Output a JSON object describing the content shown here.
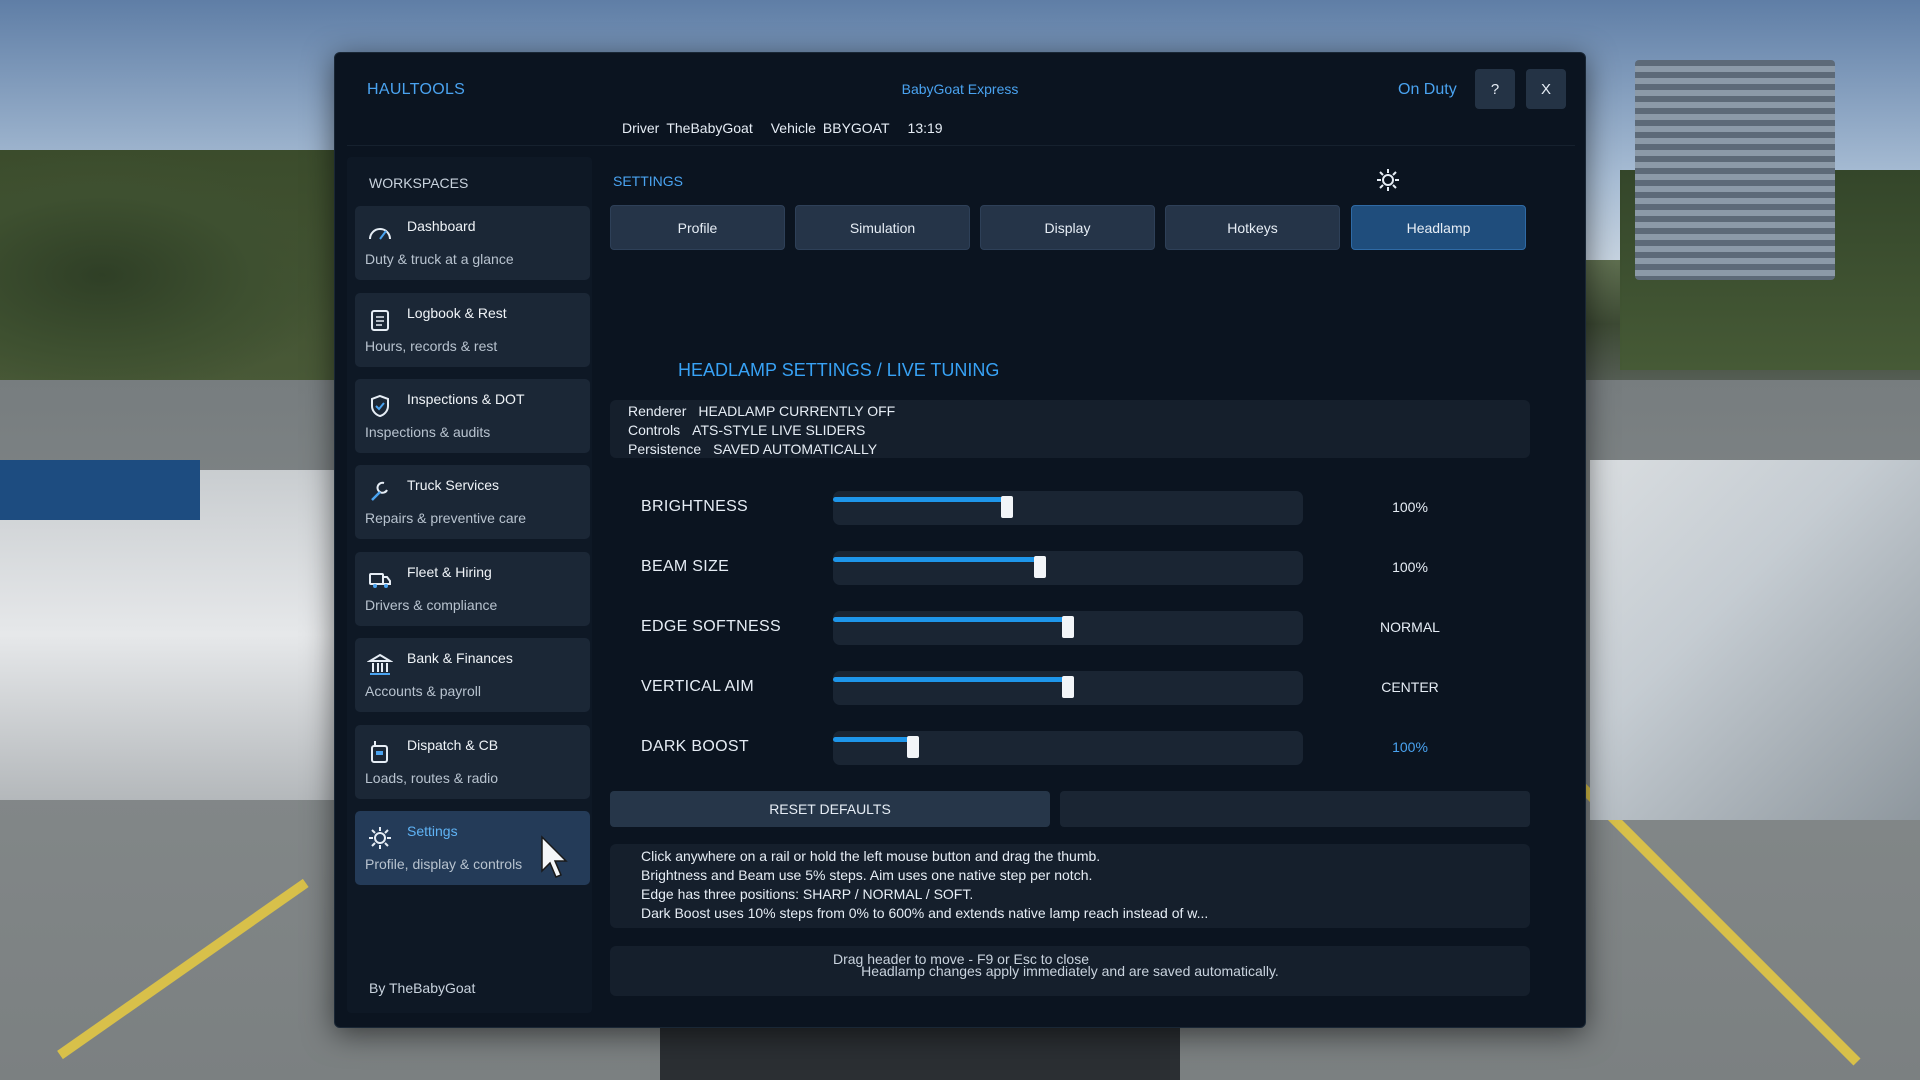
{
  "header": {
    "app_title": "HAULTOOLS",
    "company": "BabyGoat Express",
    "driver_label": "Driver",
    "driver_value": "TheBabyGoat",
    "vehicle_label": "Vehicle",
    "vehicle_value": "BBYGOAT",
    "time": "13:19",
    "duty_status": "On Duty",
    "help_label": "?",
    "close_label": "X"
  },
  "sidebar": {
    "section_label": "WORKSPACES",
    "items": [
      {
        "title": "Dashboard",
        "subtitle": "Duty & truck at a glance",
        "icon": "gauge-icon"
      },
      {
        "title": "Logbook & Rest",
        "subtitle": "Hours, records & rest",
        "icon": "logbook-icon"
      },
      {
        "title": "Inspections & DOT",
        "subtitle": "Inspections & audits",
        "icon": "shield-check-icon"
      },
      {
        "title": "Truck Services",
        "subtitle": "Repairs & preventive care",
        "icon": "wrench-icon"
      },
      {
        "title": "Fleet & Hiring",
        "subtitle": "Drivers & compliance",
        "icon": "truck-icon"
      },
      {
        "title": "Bank & Finances",
        "subtitle": "Accounts & payroll",
        "icon": "bank-icon"
      },
      {
        "title": "Dispatch & CB",
        "subtitle": "Loads, routes & radio",
        "icon": "radio-icon"
      },
      {
        "title": "Settings",
        "subtitle": "Profile, display & controls",
        "icon": "gear-icon",
        "active": true
      }
    ],
    "byline": "By TheBabyGoat"
  },
  "main": {
    "section_label": "SETTINGS",
    "tabs": [
      "Profile",
      "Simulation",
      "Display",
      "Hotkeys",
      "Headlamp"
    ],
    "active_tab": "Headlamp",
    "headlamp_title": "HEADLAMP SETTINGS / LIVE TUNING",
    "info": [
      {
        "key": "Renderer",
        "value": "HEADLAMP CURRENTLY OFF"
      },
      {
        "key": "Controls",
        "value": "ATS-STYLE LIVE SLIDERS"
      },
      {
        "key": "Persistence",
        "value": "SAVED AUTOMATICALLY"
      }
    ],
    "sliders": [
      {
        "label": "BRIGHTNESS",
        "value_text": "100%",
        "fraction": 0.37
      },
      {
        "label": "BEAM SIZE",
        "value_text": "100%",
        "fraction": 0.44
      },
      {
        "label": "EDGE SOFTNESS",
        "value_text": "NORMAL",
        "fraction": 0.5
      },
      {
        "label": "VERTICAL AIM",
        "value_text": "CENTER",
        "fraction": 0.5
      },
      {
        "label": "DARK BOOST",
        "value_text": "100%",
        "fraction": 0.17,
        "accent": true
      }
    ],
    "reset_label": "RESET DEFAULTS",
    "help_lines": [
      "Click anywhere on a rail or hold the left mouse button and drag the thumb.",
      "Brightness and Beam use 5% steps. Aim uses one native step per notch.",
      "Edge has three positions: SHARP / NORMAL / SOFT.",
      "Dark Boost uses 10% steps from 0% to 600% and extends native lamp reach instead of w..."
    ],
    "notice": "Headlamp changes apply immediately and are saved automatically."
  },
  "footer_hint": "Drag header to move - F9 or Esc to close",
  "colors": {
    "accent": "#4aa3f0",
    "window_bg": "#0b1420",
    "active_tab": "#1f4d7c",
    "slider_fill": "#1e96ea"
  }
}
